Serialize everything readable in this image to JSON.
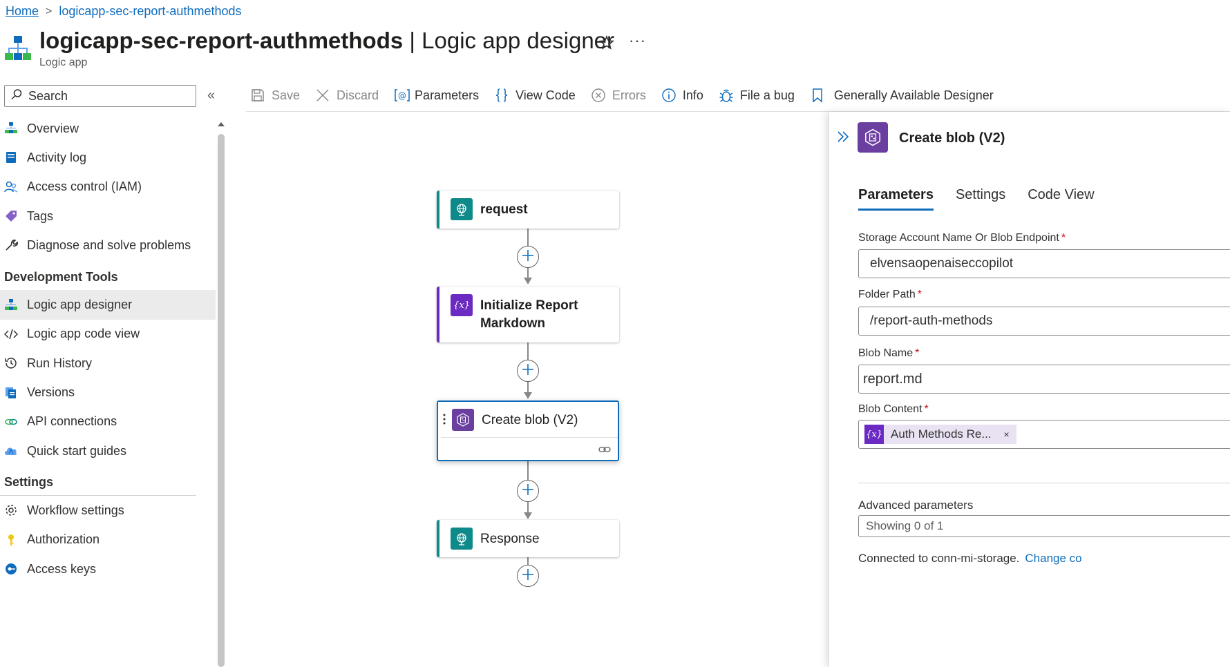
{
  "breadcrumb": {
    "home": "Home",
    "current": "logicapp-sec-report-authmethods"
  },
  "header": {
    "resource_name": "logicapp-sec-report-authmethods",
    "separator": " | ",
    "page_name": "Logic app designer",
    "subtitle": "Logic app",
    "more": "···"
  },
  "sidebar": {
    "search_placeholder": "Search",
    "collapse_glyph": "«",
    "top_items": [
      {
        "label": "Overview",
        "icon": "overview-icon"
      },
      {
        "label": "Activity log",
        "icon": "activity-log-icon"
      },
      {
        "label": "Access control (IAM)",
        "icon": "iam-icon"
      },
      {
        "label": "Tags",
        "icon": "tag-icon"
      },
      {
        "label": "Diagnose and solve problems",
        "icon": "wrench-icon"
      }
    ],
    "dev_tools_heading": "Development Tools",
    "dev_items": [
      {
        "label": "Logic app designer",
        "icon": "designer-icon",
        "active": true
      },
      {
        "label": "Logic app code view",
        "icon": "code-icon"
      },
      {
        "label": "Run History",
        "icon": "history-icon"
      },
      {
        "label": "Versions",
        "icon": "versions-icon"
      },
      {
        "label": "API connections",
        "icon": "connection-icon"
      },
      {
        "label": "Quick start guides",
        "icon": "cloud-icon"
      }
    ],
    "settings_heading": "Settings",
    "settings_items": [
      {
        "label": "Workflow settings",
        "icon": "gear-icon"
      },
      {
        "label": "Authorization",
        "icon": "key-icon"
      },
      {
        "label": "Access keys",
        "icon": "access-keys-icon"
      }
    ]
  },
  "toolbar": {
    "save": "Save",
    "discard": "Discard",
    "parameters": "Parameters",
    "view_code": "View Code",
    "errors": "Errors",
    "info": "Info",
    "file_bug": "File a bug",
    "ga_designer": "Generally Available Designer"
  },
  "workflow": {
    "steps": [
      {
        "title": "request",
        "kind": "http-trigger",
        "color": "#0f8a8a"
      },
      {
        "title_line1": "Initialize Report",
        "title_line2": "Markdown",
        "kind": "variable",
        "color": "#6b2bc2"
      },
      {
        "title": "Create blob (V2)",
        "kind": "azure-blob",
        "color": "#6b3fa0",
        "selected": true
      },
      {
        "title": "Response",
        "kind": "http-response",
        "color": "#0f8a8a"
      }
    ]
  },
  "panel": {
    "title": "Create blob (V2)",
    "tabs": [
      "Parameters",
      "Settings",
      "Code View"
    ],
    "active_tab": "Parameters",
    "fields": [
      {
        "label": "Storage Account Name Or Blob Endpoint",
        "required": "*",
        "value": "elvensaopenaiseccopilot"
      },
      {
        "label": "Folder Path",
        "required": "*",
        "value": "/report-auth-methods"
      },
      {
        "label": "Blob Name",
        "required": "*",
        "value": "report.md"
      },
      {
        "label": "Blob Content",
        "required": "*",
        "token": "Auth Methods Re...",
        "token_remove": "×"
      }
    ],
    "advanced_label": "Advanced parameters",
    "advanced_value": "Showing 0 of 1",
    "connection_text": "Connected to conn-mi-storage.",
    "change_link": "Change co"
  },
  "colors": {
    "accent": "#0f6cbd",
    "active_nav": "#ebebeb",
    "http_teal": "#0f8a8a",
    "variable_purple": "#6b2bc2",
    "blob_purple": "#6b3fa0",
    "required": "#c50f1f"
  }
}
